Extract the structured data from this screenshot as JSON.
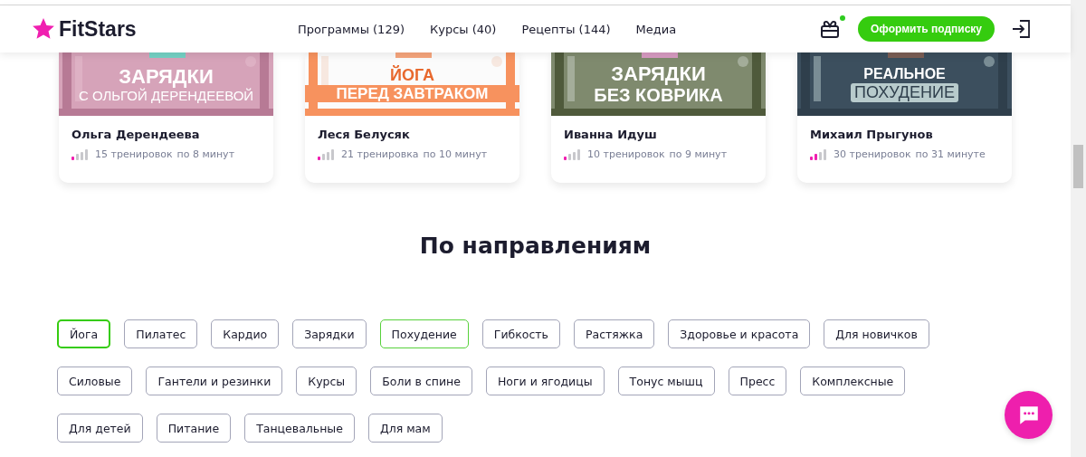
{
  "header": {
    "logo": "FitStars",
    "nav": [
      "Программы (129)",
      "Курсы (40)",
      "Рецепты (144)",
      "Медиа"
    ],
    "gift_has_notification": true,
    "subscribe_button": "Оформить подписку"
  },
  "cards": [
    {
      "banner_lines": [
        "ЗАРЯДКИ",
        "С ОЛЬГОЙ ДЕРЕНДЕЕВОЙ"
      ],
      "kind": "pink",
      "name": "Ольга Дерендеева",
      "level": 0.25,
      "workouts": "15 тренировок",
      "duration": "по 8 минут"
    },
    {
      "banner_lines": [
        "ЙОГА",
        "ПЕРЕД ЗАВТРАКОМ"
      ],
      "kind": "orange",
      "name": "Леся Белусяк",
      "level": 0.25,
      "workouts": "21 тренировка",
      "duration": "по 10 минут"
    },
    {
      "banner_lines": [
        "ЗАРЯДКИ",
        "БЕЗ КОВРИКА"
      ],
      "kind": "park",
      "name": "Иванна Идуш",
      "level": 0.25,
      "workouts": "10 тренировок",
      "duration": "по 9 минут"
    },
    {
      "banner_lines": [
        "РЕАЛЬНОЕ",
        "ПОХУДЕНИЕ"
      ],
      "kind": "slate",
      "name": "Михаил Прыгунов",
      "level": 0.5,
      "workouts": "30 тренировок",
      "duration": "по 31 минуте"
    }
  ],
  "section_title": "По направлениям",
  "tag_rows": [
    [
      {
        "label": "Йога",
        "selected": true,
        "hovered": false
      },
      {
        "label": "Пилатес",
        "selected": false,
        "hovered": false
      },
      {
        "label": "Кардио",
        "selected": false,
        "hovered": false
      },
      {
        "label": "Зарядки",
        "selected": false,
        "hovered": false
      },
      {
        "label": "Похудение",
        "selected": false,
        "hovered": true
      },
      {
        "label": "Гибкость",
        "selected": false,
        "hovered": false
      },
      {
        "label": "Растяжка",
        "selected": false,
        "hovered": false
      },
      {
        "label": "Здоровье и красота",
        "selected": false,
        "hovered": false
      },
      {
        "label": "Для новичков",
        "selected": false,
        "hovered": false
      }
    ],
    [
      {
        "label": "Силовые",
        "selected": false,
        "hovered": false
      },
      {
        "label": "Гантели и резинки",
        "selected": false,
        "hovered": false
      },
      {
        "label": "Курсы",
        "selected": false,
        "hovered": false
      },
      {
        "label": "Боли в спине",
        "selected": false,
        "hovered": false
      },
      {
        "label": "Ноги и ягодицы",
        "selected": false,
        "hovered": false
      },
      {
        "label": "Тонус мышц",
        "selected": false,
        "hovered": false
      },
      {
        "label": "Пресс",
        "selected": false,
        "hovered": false
      },
      {
        "label": "Комплексные",
        "selected": false,
        "hovered": false
      }
    ],
    [
      {
        "label": "Для детей",
        "selected": false,
        "hovered": false
      },
      {
        "label": "Питание",
        "selected": false,
        "hovered": false
      },
      {
        "label": "Танцевальные",
        "selected": false,
        "hovered": false
      },
      {
        "label": "Для мам",
        "selected": false,
        "hovered": false
      }
    ]
  ]
}
